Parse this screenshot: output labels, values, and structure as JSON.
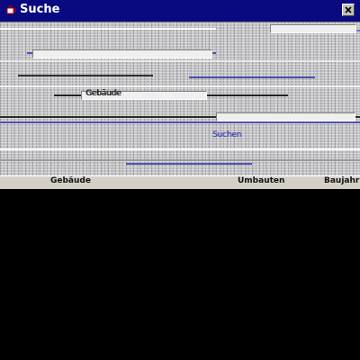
{
  "window": {
    "title": "Suche",
    "close_icon": "close-icon",
    "app_icon": "java-cup-icon"
  },
  "form": {
    "buttons": [
      "Suchen"
    ],
    "labels": [
      "Gebäude"
    ]
  },
  "results": {
    "columns": [
      "Gebäude",
      "Umbauten",
      "Baujahr"
    ]
  },
  "colors": {
    "titlebar": "#0a0a80",
    "window_bg": "#c0c0c0",
    "background": "#000000"
  }
}
